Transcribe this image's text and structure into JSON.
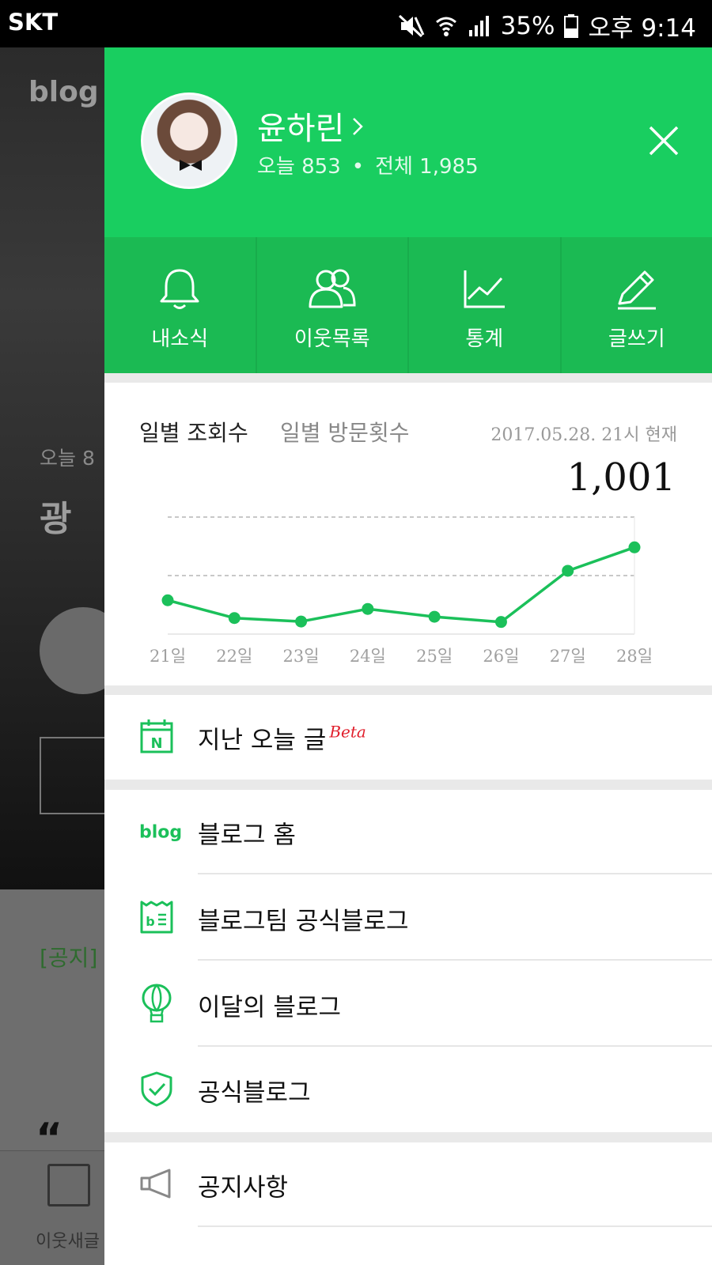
{
  "status_bar": {
    "carrier": "SKT",
    "battery": "35%",
    "time": "오후 9:14"
  },
  "background_page": {
    "logo": "blog",
    "today_prefix": "오늘 8",
    "title_fragment": "광",
    "notice_fragment": "[공지]",
    "tab_label": "이웃새글"
  },
  "profile": {
    "name": "윤하린",
    "today_label": "오늘 853",
    "total_label": "전체 1,985"
  },
  "quick_actions": [
    {
      "label": "내소식",
      "icon": "bell-icon"
    },
    {
      "label": "이웃목록",
      "icon": "people-icon"
    },
    {
      "label": "통계",
      "icon": "stats-icon"
    },
    {
      "label": "글쓰기",
      "icon": "pencil-icon"
    }
  ],
  "stats": {
    "tab_active": "일별 조회수",
    "tab_inactive": "일별 방문횟수",
    "as_of": "2017.05.28. 21시 현재",
    "value": "1,001"
  },
  "chart_data": {
    "type": "line",
    "categories": [
      "21일",
      "22일",
      "23일",
      "24일",
      "25일",
      "26일",
      "27일",
      "28일"
    ],
    "values": [
      390,
      185,
      145,
      290,
      200,
      140,
      730,
      1001
    ],
    "ylim": [
      0,
      1350
    ],
    "grid": true
  },
  "menu": {
    "past_today": "지난 오늘 글",
    "beta": "Beta",
    "blog_home": "블로그 홈",
    "blog_icon_word": "blog",
    "team_blog": "블로그팀 공식블로그",
    "month_blog": "이달의 블로그",
    "official_blog": "공식블로그",
    "notice": "공지사항"
  },
  "colors": {
    "brand_green": "#19ce60",
    "quick_bar_green": "#1bba53",
    "beta_red": "#e01e2b"
  }
}
